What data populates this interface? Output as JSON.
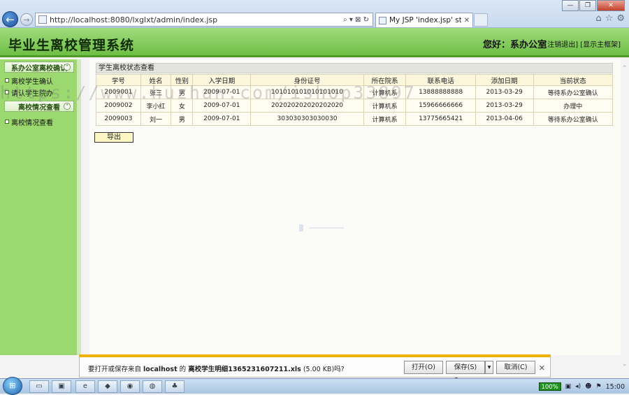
{
  "browser": {
    "window_buttons": [
      "—",
      "❐",
      "✕"
    ],
    "url": "http://localhost:8080/lxglxt/admin/index.jsp",
    "address_actions": "⌕ ▾ ⊠ ↻",
    "tab_title": "My JSP 'index.jsp' startin...",
    "tab_close": "✕",
    "tool_icons": [
      "home-icon",
      "star-icon",
      "gear-icon"
    ]
  },
  "header": {
    "title": "毕业生离校管理系统",
    "greeting": "您好：系办公室",
    "logout": "[注销退出]",
    "show_home": "[显示主框架]"
  },
  "sidebar": {
    "sections": [
      {
        "title": "系办公室离校确认",
        "items": [
          "离校学生确认",
          "请认学生院办"
        ]
      },
      {
        "title": "离校情况查看",
        "items": [
          "离校情况查看"
        ]
      }
    ]
  },
  "main": {
    "panel_title": "学生离校状态查看",
    "columns": [
      "学号",
      "姓名",
      "性别",
      "入学日期",
      "身份证号",
      "所在院系",
      "联系电话",
      "添加日期",
      "当前状态"
    ],
    "rows": [
      [
        "2009001",
        "张三",
        "男",
        "2009-07-01",
        "101010101010101010",
        "计算机系",
        "13888888888",
        "2013-03-29",
        "等待系办公室确认"
      ],
      [
        "2009002",
        "李小红",
        "女",
        "2009-07-01",
        "202020202020202020",
        "计算机系",
        "15966666666",
        "2013-03-29",
        "办理中"
      ],
      [
        "2009003",
        "刘一",
        "男",
        "2009-07-01",
        "303030303030030",
        "计算机系",
        "13775665421",
        "2013-04-06",
        "等待系办公室确认"
      ]
    ],
    "export_label": "导出"
  },
  "watermark": "https://www.huzhan.com/ishop33897",
  "download_bar": {
    "prefix": "要打开或保存来自",
    "host": "localhost",
    "middle": "的",
    "filename": "离校学生明细1365231607211.xls",
    "size": "(5.00 KB)",
    "suffix": "吗?",
    "open_label": "打开(O)",
    "save_label": "保存(S)",
    "save_menu": "▾",
    "cancel_label": "取消(C)",
    "close": "✕"
  },
  "taskbar": {
    "battery": "100%",
    "time": "15:00"
  },
  "colors": {
    "header_green": "#6fbf45",
    "sidebar_green": "#9bd86d",
    "download_accent": "#f0b100"
  }
}
